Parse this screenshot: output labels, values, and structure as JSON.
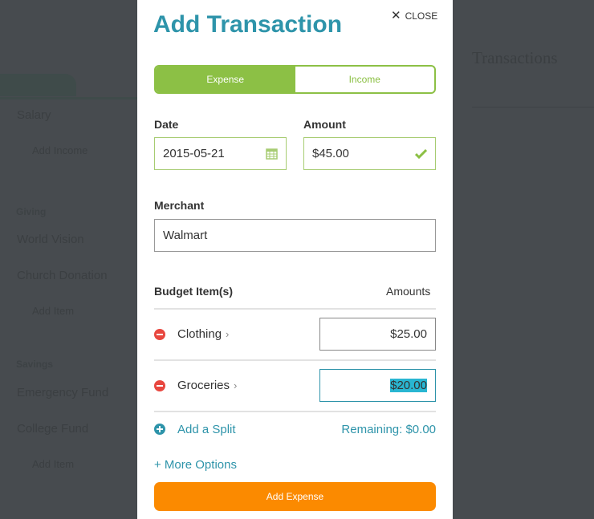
{
  "background": {
    "sidebar": {
      "items": [
        "Salary",
        "Add Income",
        "Giving",
        "World Vision",
        "Church Donation",
        "Add Item",
        "Savings",
        "Emergency Fund",
        "College Fund",
        "Add Item"
      ]
    },
    "main": {
      "title": "Transactions"
    }
  },
  "modal": {
    "title": "Add Transaction",
    "close_label": "CLOSE",
    "tabs": [
      {
        "label": "Expense",
        "active": true
      },
      {
        "label": "Income",
        "active": false
      }
    ],
    "date": {
      "label": "Date",
      "value": "2015-05-21"
    },
    "amount": {
      "label": "Amount",
      "value": "$45.00"
    },
    "merchant": {
      "label": "Merchant",
      "value": "Walmart"
    },
    "budget": {
      "header": "Budget Item(s)",
      "amounts_header": "Amounts",
      "items": [
        {
          "name": "Clothing",
          "amount": "$25.00"
        },
        {
          "name": "Groceries",
          "amount": "$20.00"
        }
      ]
    },
    "add_split": "Add a Split",
    "remaining": "Remaining: $0.00",
    "more_options": "+ More Options",
    "submit": "Add Expense"
  },
  "colors": {
    "accent_green": "#8cc045",
    "teal": "#2e94aa",
    "orange": "#fb8a00",
    "remove_red": "#e8473f"
  }
}
